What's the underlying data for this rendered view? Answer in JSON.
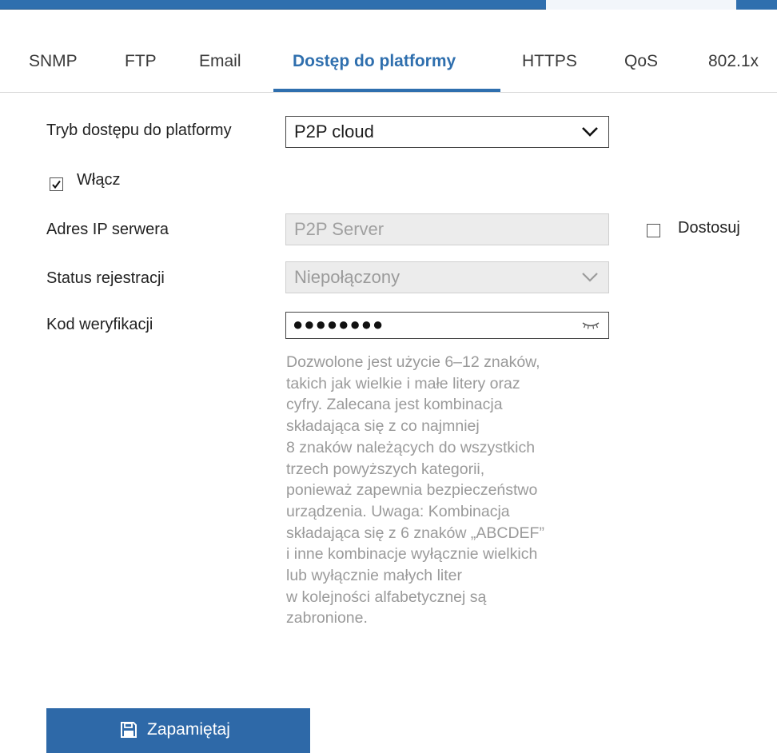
{
  "tabs": [
    {
      "label": "SNMP",
      "active": false
    },
    {
      "label": "FTP",
      "active": false
    },
    {
      "label": "Email",
      "active": false
    },
    {
      "label": "Dostęp do platformy",
      "active": true
    },
    {
      "label": "HTTPS",
      "active": false
    },
    {
      "label": "QoS",
      "active": false
    },
    {
      "label": "802.1x",
      "active": false
    }
  ],
  "form": {
    "access_mode": {
      "label": "Tryb dostępu do platformy",
      "value": "P2P cloud"
    },
    "enable": {
      "label": "Włącz",
      "checked": true
    },
    "server_ip": {
      "label": "Adres IP serwera",
      "value": "P2P Server",
      "disabled": true
    },
    "customize": {
      "label": "Dostosuj",
      "checked": false
    },
    "registration_status": {
      "label": "Status rejestracji",
      "value": "Niepołączony",
      "disabled": true
    },
    "verification_code": {
      "label": "Kod weryfikacji",
      "value": "●●●●●●●●"
    },
    "hint_lines": [
      "Dozwolone jest użycie 6–12 znaków,",
      "takich jak wielkie i małe litery oraz",
      "cyfry. Zalecana jest kombinacja",
      "składająca się z co najmniej",
      "8 znaków należących do wszystkich",
      "trzech powyższych kategorii,",
      "ponieważ zapewnia bezpieczeństwo",
      "urządzenia. Uwaga: Kombinacja",
      "składająca się z 6 znaków „ABCDEF”",
      "i inne kombinacje wyłącznie wielkich",
      "lub wyłącznie małych liter",
      "w kolejności alfabetycznej są",
      "zabronione."
    ]
  },
  "save_button": {
    "label": "Zapamiętaj",
    "icon": "save-icon"
  },
  "colors": {
    "accent": "#2f6fae",
    "button": "#2e69a8",
    "hint_text": "#9a9a9a",
    "disabled_bg": "#ececec"
  }
}
